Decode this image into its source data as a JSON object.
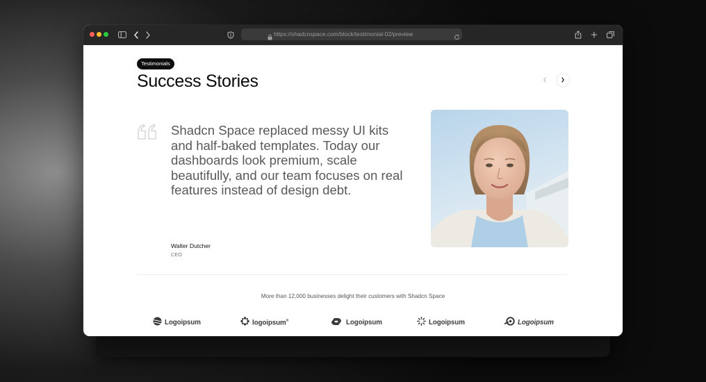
{
  "browser": {
    "url": "https://shadcnspace.com/block/testimonial-02/preview"
  },
  "section": {
    "badge": "Testimonials",
    "title": "Success Stories"
  },
  "testimonial": {
    "quote": "Shadcn Space replaced messy UI kits and half-baked templates. Today our dashboards look premium, scale beautifully, and our team focuses on real features instead of design debt.",
    "author_name": "Walter Dutcher",
    "author_role": "CEO"
  },
  "trust": {
    "text": "More than 12,000 businesses delight their customers with Shadcn Space"
  },
  "logos": [
    {
      "name": "Logoipsum"
    },
    {
      "name": "logoipsum",
      "sup": "®"
    },
    {
      "name": "Logoipsum"
    },
    {
      "name": "Logoipsum"
    },
    {
      "name": "Logoipsum"
    }
  ],
  "icons": {
    "prev": "chevron-left-icon",
    "next": "chevron-right-icon",
    "quote": "quote-mark-icon"
  }
}
